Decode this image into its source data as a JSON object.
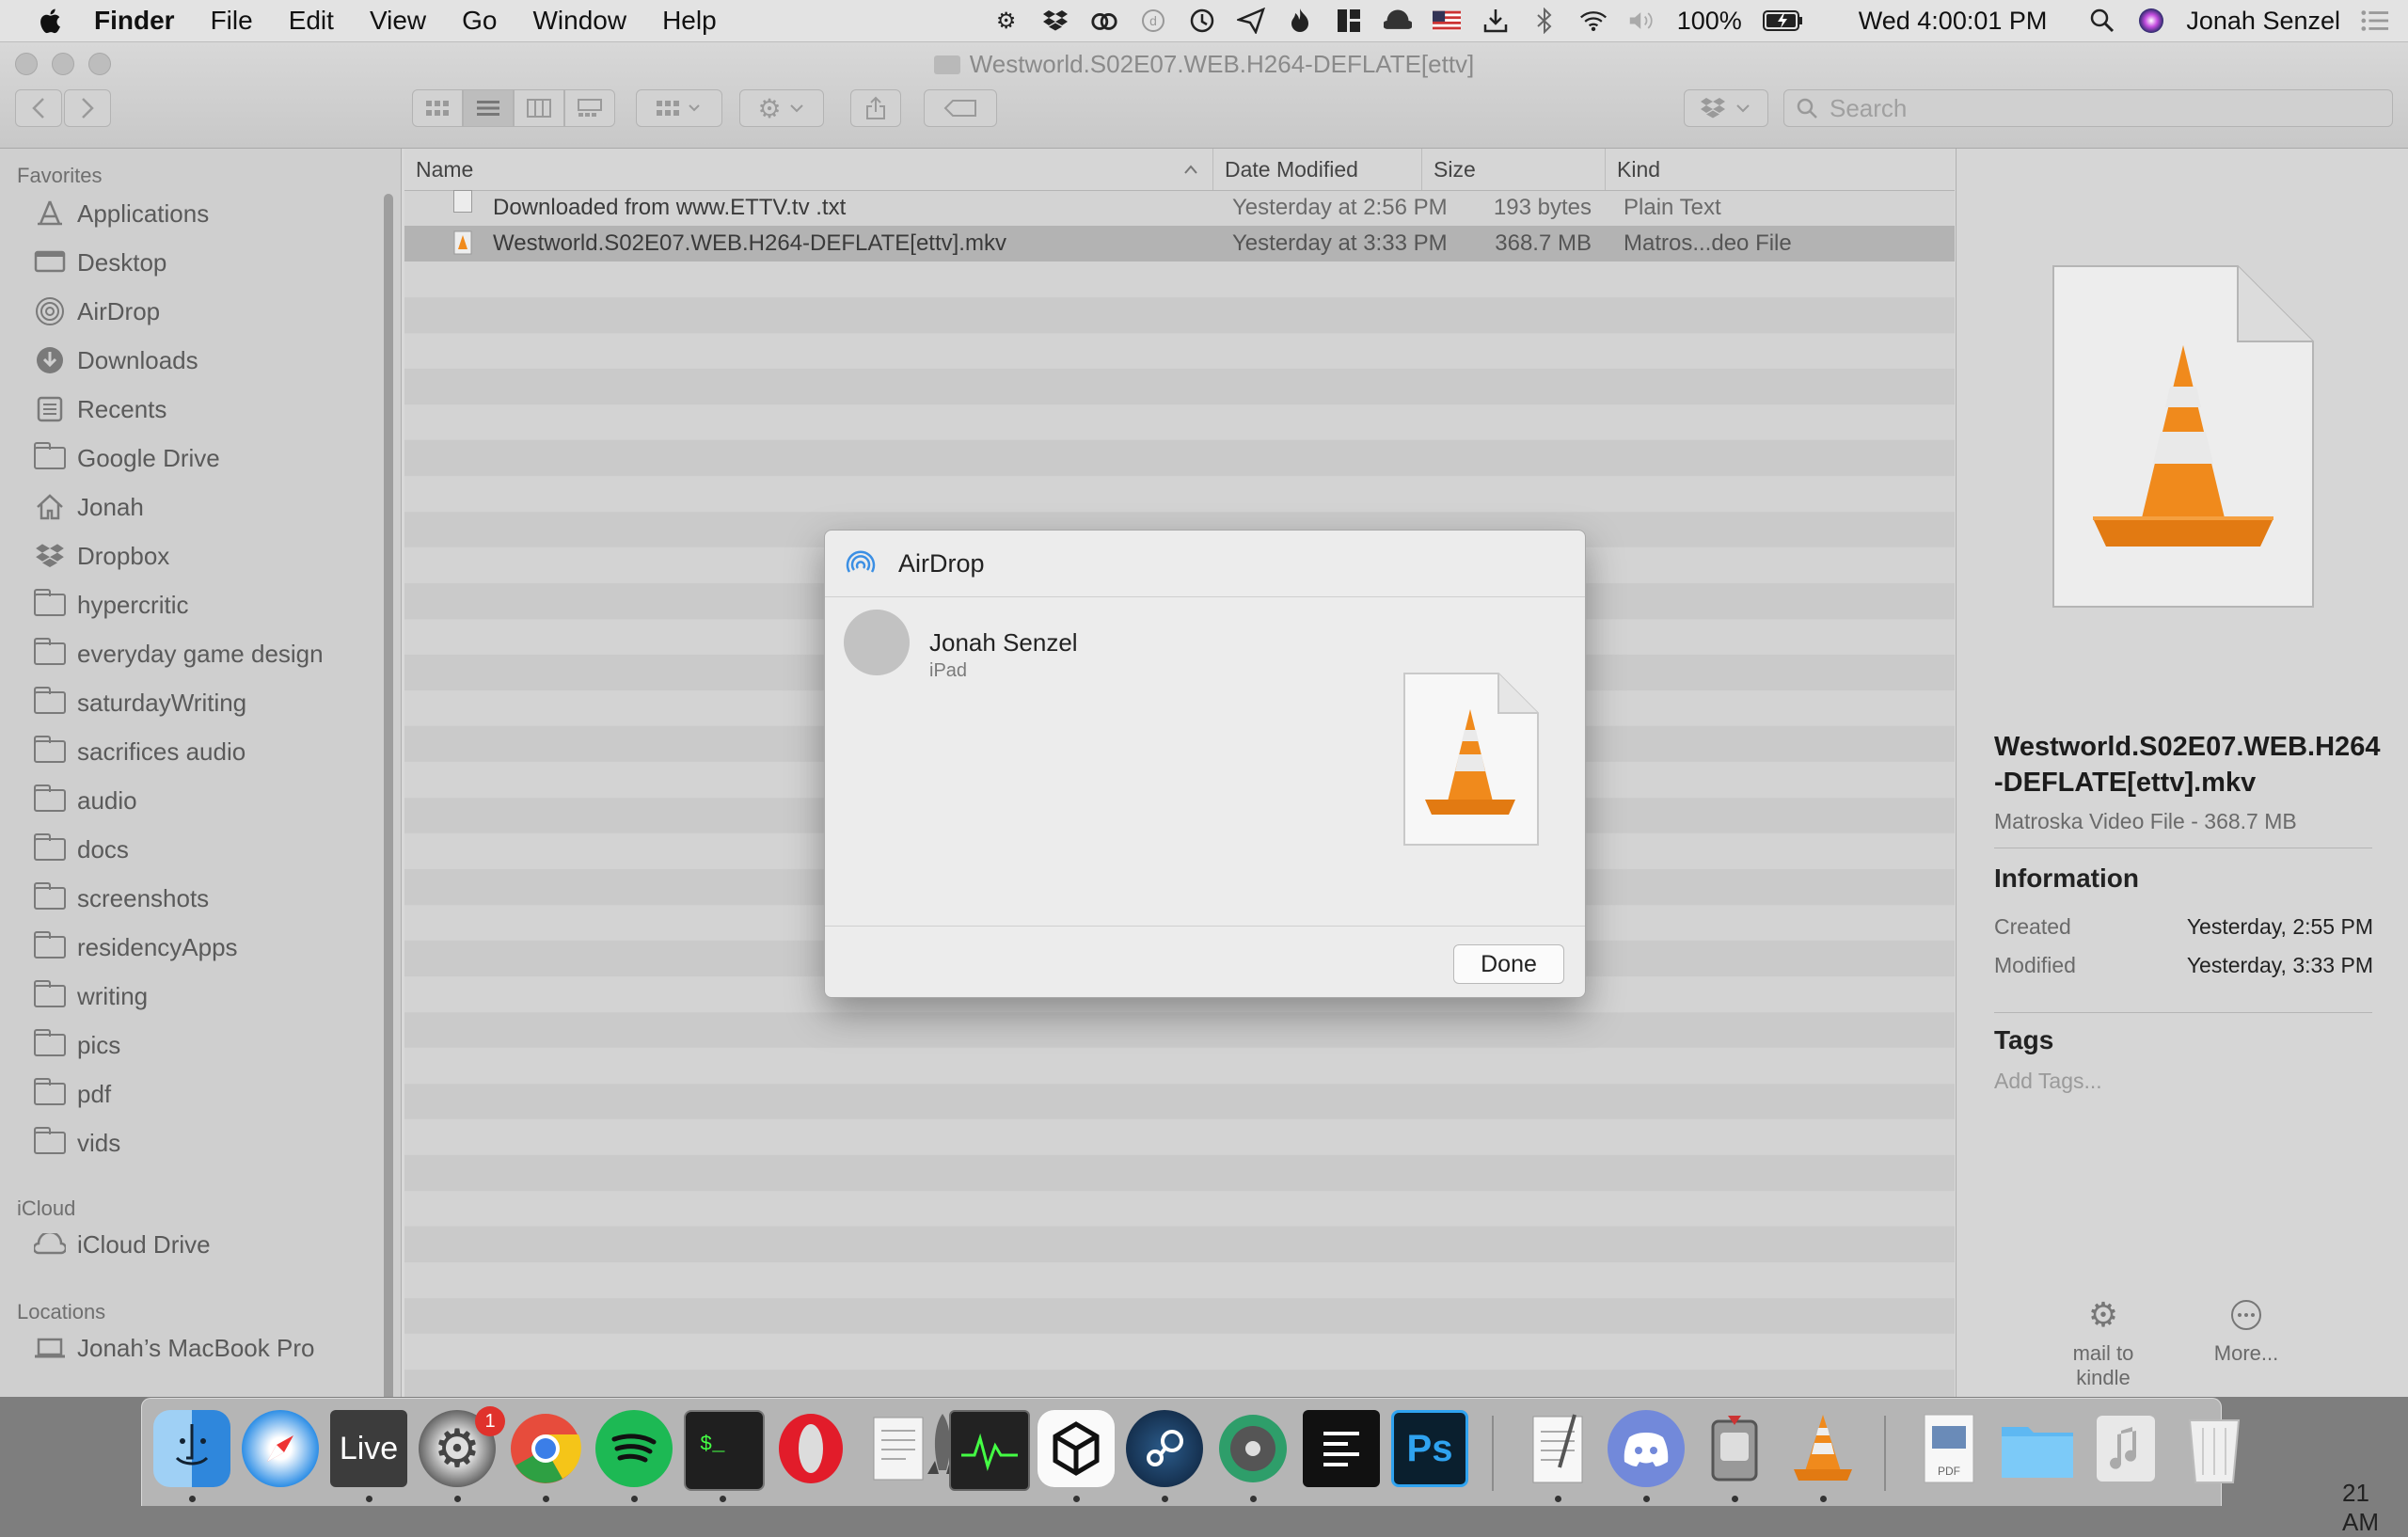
{
  "menubar": {
    "items": [
      "Finder",
      "File",
      "Edit",
      "View",
      "Go",
      "Window",
      "Help"
    ],
    "battery": "100%",
    "clock": "Wed 4:00:01 PM",
    "user": "Jonah Senzel",
    "status_icons": [
      "gear-icon",
      "dropbox-icon",
      "creative-cloud-icon",
      "dash-icon",
      "time-machine-icon",
      "send-icon",
      "flame-icon",
      "grid-icon",
      "cloud-icon",
      "flag-icon",
      "download-icon",
      "bluetooth-icon",
      "wifi-icon",
      "volume-icon",
      "battery-icon"
    ]
  },
  "window": {
    "title": "Westworld.S02E07.WEB.H264-DEFLATE[ettv]",
    "search_placeholder": "Search"
  },
  "sidebar": {
    "favorites_header": "Favorites",
    "favorites": [
      {
        "label": "Applications",
        "icon": "applications-icon"
      },
      {
        "label": "Desktop",
        "icon": "desktop-icon"
      },
      {
        "label": "AirDrop",
        "icon": "airdrop-icon"
      },
      {
        "label": "Downloads",
        "icon": "downloads-icon"
      },
      {
        "label": "Recents",
        "icon": "recents-icon"
      },
      {
        "label": "Google Drive",
        "icon": "folder-icon"
      },
      {
        "label": "Jonah",
        "icon": "home-icon"
      },
      {
        "label": "Dropbox",
        "icon": "dropbox-icon"
      },
      {
        "label": "hypercritic",
        "icon": "folder-icon"
      },
      {
        "label": "everyday game design",
        "icon": "folder-icon"
      },
      {
        "label": "saturdayWriting",
        "icon": "folder-icon"
      },
      {
        "label": "sacrifices audio",
        "icon": "folder-icon"
      },
      {
        "label": "audio",
        "icon": "folder-icon"
      },
      {
        "label": "docs",
        "icon": "folder-icon"
      },
      {
        "label": "screenshots",
        "icon": "folder-icon"
      },
      {
        "label": "residencyApps",
        "icon": "folder-icon"
      },
      {
        "label": "writing",
        "icon": "folder-icon"
      },
      {
        "label": "pics",
        "icon": "folder-icon"
      },
      {
        "label": "pdf",
        "icon": "folder-icon"
      },
      {
        "label": "vids",
        "icon": "folder-icon"
      }
    ],
    "icloud_header": "iCloud",
    "icloud_drive": "iCloud Drive",
    "locations_header": "Locations",
    "macbook": "Jonah’s MacBook Pro"
  },
  "filelist": {
    "columns": {
      "name": "Name",
      "date": "Date Modified",
      "size": "Size",
      "kind": "Kind"
    },
    "rows": [
      {
        "name": "Downloaded from www.ETTV.tv .txt",
        "date": "Yesterday at 2:56 PM",
        "size": "193 bytes",
        "kind": "Plain Text"
      },
      {
        "name": "Westworld.S02E07.WEB.H264-DEFLATE[ettv].mkv",
        "date": "Yesterday at 3:33 PM",
        "size": "368.7 MB",
        "kind": "Matros...deo File"
      }
    ]
  },
  "preview": {
    "filename": "Westworld.S02E07.WEB.H264-DEFLATE[ettv].mkv",
    "kind": "Matroska Video File - 368.7 MB",
    "info_header": "Information",
    "created_label": "Created",
    "created_value": "Yesterday, 2:55 PM",
    "modified_label": "Modified",
    "modified_value": "Yesterday, 3:33 PM",
    "tags_header": "Tags",
    "add_tags": "Add Tags...",
    "action1": "mail to kindle",
    "action2": "More..."
  },
  "airdrop": {
    "title": "AirDrop",
    "recipient_name": "Jonah Senzel",
    "recipient_device": "iPad",
    "done_label": "Done"
  },
  "dock": {
    "apps": [
      "Finder",
      "Safari",
      "Live",
      "System Preferences",
      "Chrome",
      "Spotify",
      "Terminal",
      "Opera",
      "Preview Notes",
      "Rocket",
      "Activity Monitor",
      "Unity",
      "Steam",
      "Reaper",
      "Text Editor",
      "Photoshop",
      "TextEdit",
      "Discord",
      "Transmit",
      "VLC",
      "PDF Document",
      "Folder",
      "Music",
      "Trash"
    ],
    "live_label": "Live",
    "ps_label": "Ps",
    "badge_count": "1",
    "clock_fragment": "21 AM"
  },
  "colors": {
    "vlc_orange": "#f08a1c",
    "selection": "#b3b3b3"
  }
}
